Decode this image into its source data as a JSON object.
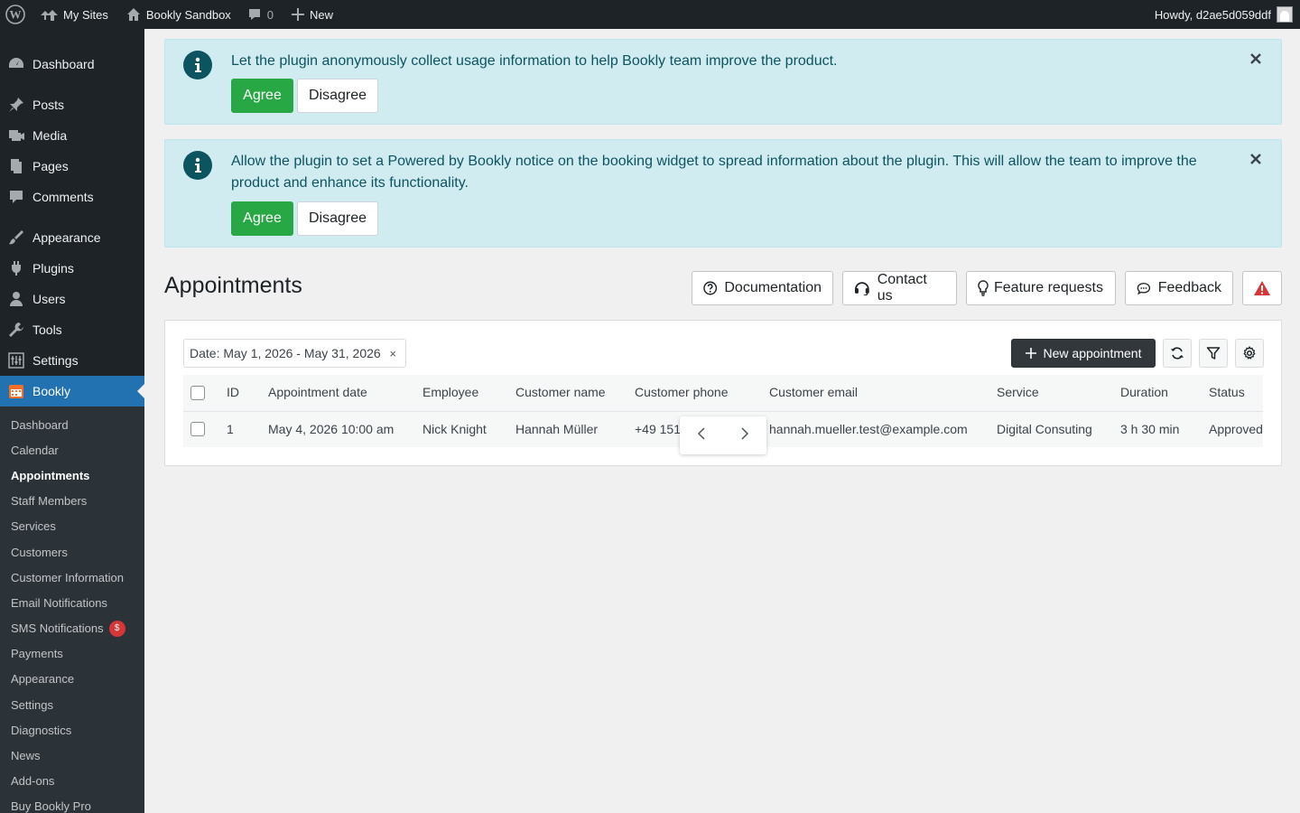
{
  "admin_bar": {
    "my_sites": "My Sites",
    "site_name": "Bookly Sandbox",
    "comments_count": "0",
    "new_label": "New",
    "howdy": "Howdy, d2ae5d059ddf"
  },
  "sidebar": {
    "main": [
      {
        "label": "Dashboard",
        "icon": "dashboard-icon"
      },
      {
        "label": "Posts",
        "icon": "pin-icon"
      },
      {
        "label": "Media",
        "icon": "media-icon"
      },
      {
        "label": "Pages",
        "icon": "pages-icon"
      },
      {
        "label": "Comments",
        "icon": "comment-icon"
      },
      {
        "label": "Appearance",
        "icon": "brush-icon"
      },
      {
        "label": "Plugins",
        "icon": "plug-icon"
      },
      {
        "label": "Users",
        "icon": "user-icon"
      },
      {
        "label": "Tools",
        "icon": "wrench-icon"
      },
      {
        "label": "Settings",
        "icon": "sliders-icon"
      },
      {
        "label": "Bookly",
        "icon": "calendar-icon"
      }
    ],
    "submenu": [
      "Dashboard",
      "Calendar",
      "Appointments",
      "Staff Members",
      "Services",
      "Customers",
      "Customer Information",
      "Email Notifications",
      "SMS Notifications",
      "Payments",
      "Appearance",
      "Settings",
      "Diagnostics",
      "News",
      "Add-ons",
      "Buy Bookly Pro"
    ],
    "sms_badge": "$"
  },
  "notices": [
    {
      "message": "Let the plugin anonymously collect usage information to help Bookly team improve the product.",
      "agree": "Agree",
      "disagree": "Disagree"
    },
    {
      "message": "Allow the plugin to set a Powered by Bookly notice on the booking widget to spread information about the plugin. This will allow the team to improve the product and enhance its functionality.",
      "agree": "Agree",
      "disagree": "Disagree"
    }
  ],
  "header": {
    "title": "Appointments",
    "documentation": "Documentation",
    "contact": "Contact us",
    "feature_requests": "Feature requests",
    "feedback": "Feedback"
  },
  "toolbar": {
    "date_filter": "Date: May 1, 2026 - May 31, 2026",
    "clear": "×",
    "new_appointment": "New appointment"
  },
  "table": {
    "columns": [
      "ID",
      "Appointment date",
      "Employee",
      "Customer name",
      "Customer phone",
      "Customer email",
      "Service",
      "Duration",
      "Status"
    ],
    "rows": [
      [
        "1",
        "May 4, 2026 10:00 am",
        "Nick Knight",
        "Hannah Müller",
        "+49 151",
        "hannah.mueller.test@example.com",
        "Digital Consuting",
        "3 h 30 min",
        "Approved"
      ]
    ]
  },
  "colors": {
    "wp_dark": "#1d2327",
    "wp_blue": "#2271b1",
    "notice_bg": "#d1ecf1",
    "agree_green": "#28a745",
    "danger_red": "#d63638"
  }
}
